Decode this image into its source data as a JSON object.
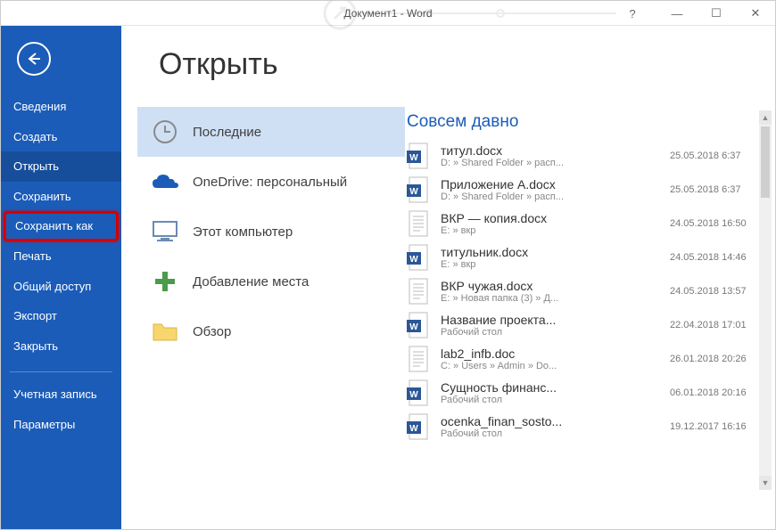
{
  "title": "Документ1 - Word",
  "wincontrols": {
    "help": "?",
    "min": "—",
    "max": "☐",
    "close": "✕"
  },
  "sidebar": {
    "items": [
      {
        "label": "Сведения"
      },
      {
        "label": "Создать"
      },
      {
        "label": "Открыть",
        "selected": true
      },
      {
        "label": "Сохранить"
      },
      {
        "label": "Сохранить как",
        "highlight": true
      },
      {
        "label": "Печать"
      },
      {
        "label": "Общий доступ"
      },
      {
        "label": "Экспорт"
      },
      {
        "label": "Закрыть"
      }
    ],
    "footer": [
      {
        "label": "Учетная запись"
      },
      {
        "label": "Параметры"
      }
    ]
  },
  "page": {
    "heading": "Открыть",
    "locations": [
      {
        "icon": "clock-icon",
        "label": "Последние",
        "selected": true
      },
      {
        "icon": "onedrive-icon",
        "label": "OneDrive: персональный",
        "sub": ""
      },
      {
        "icon": "computer-icon",
        "label": "Этот компьютер"
      },
      {
        "icon": "plus-icon",
        "label": "Добавление места"
      },
      {
        "icon": "folder-icon",
        "label": "Обзор"
      }
    ],
    "files_heading": "Совсем давно",
    "files": [
      {
        "icon": "docx",
        "name": "титул.docx",
        "path": "D: » Shared Folder » расп...",
        "date": "25.05.2018 6:37"
      },
      {
        "icon": "docx",
        "name": "Приложение А.docx",
        "path": "D: » Shared Folder » расп...",
        "date": "25.05.2018 6:37"
      },
      {
        "icon": "doc",
        "name": "ВКР — копия.docx",
        "path": "E: » вкр",
        "date": "24.05.2018 16:50"
      },
      {
        "icon": "docx",
        "name": "титульник.docx",
        "path": "E: » вкр",
        "date": "24.05.2018 14:46"
      },
      {
        "icon": "doc",
        "name": "ВКР чужая.docx",
        "path": "E: » Новая папка (3) » Д...",
        "date": "24.05.2018 13:57"
      },
      {
        "icon": "docx",
        "name": "Название проекта...",
        "path": "Рабочий стол",
        "date": "22.04.2018 17:01"
      },
      {
        "icon": "doc",
        "name": "lab2_infb.doc",
        "path": "C: » Users » Admin » Do...",
        "date": "26.01.2018 20:26"
      },
      {
        "icon": "docx",
        "name": "Сущность финанс...",
        "path": "Рабочий стол",
        "date": "06.01.2018 20:16"
      },
      {
        "icon": "docx",
        "name": "ocenka_finan_sosto...",
        "path": "Рабочий стол",
        "date": "19.12.2017 16:16"
      }
    ]
  },
  "colors": {
    "accent": "#1b5cb8",
    "select_bg": "#cfe0f5",
    "highlight_border": "#d40000"
  }
}
